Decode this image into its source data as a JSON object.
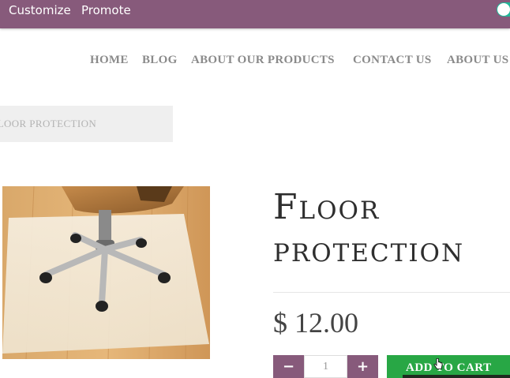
{
  "admin_bar": {
    "customize_label": "Customize",
    "promote_label": "Promote"
  },
  "nav": {
    "items": [
      {
        "label": "HOME"
      },
      {
        "label": "BLOG"
      },
      {
        "label": "ABOUT OUR PRODUCTS"
      },
      {
        "label": "CONTACT US"
      },
      {
        "label": "ABOUT US"
      }
    ]
  },
  "breadcrumb": {
    "text": "FLOOR PROTECTION"
  },
  "product": {
    "title_line1": "Floor",
    "title_line2": "protection",
    "price": "$ 12.00",
    "quantity": "1",
    "add_to_cart_label": "ADD TO CART",
    "minus_label": "−",
    "plus_label": "+"
  },
  "colors": {
    "brand": "#875a7b",
    "cart_button": "#28a745",
    "toggle_on": "#21b799"
  },
  "icons": {
    "cursor": "hand-pointer-icon"
  }
}
